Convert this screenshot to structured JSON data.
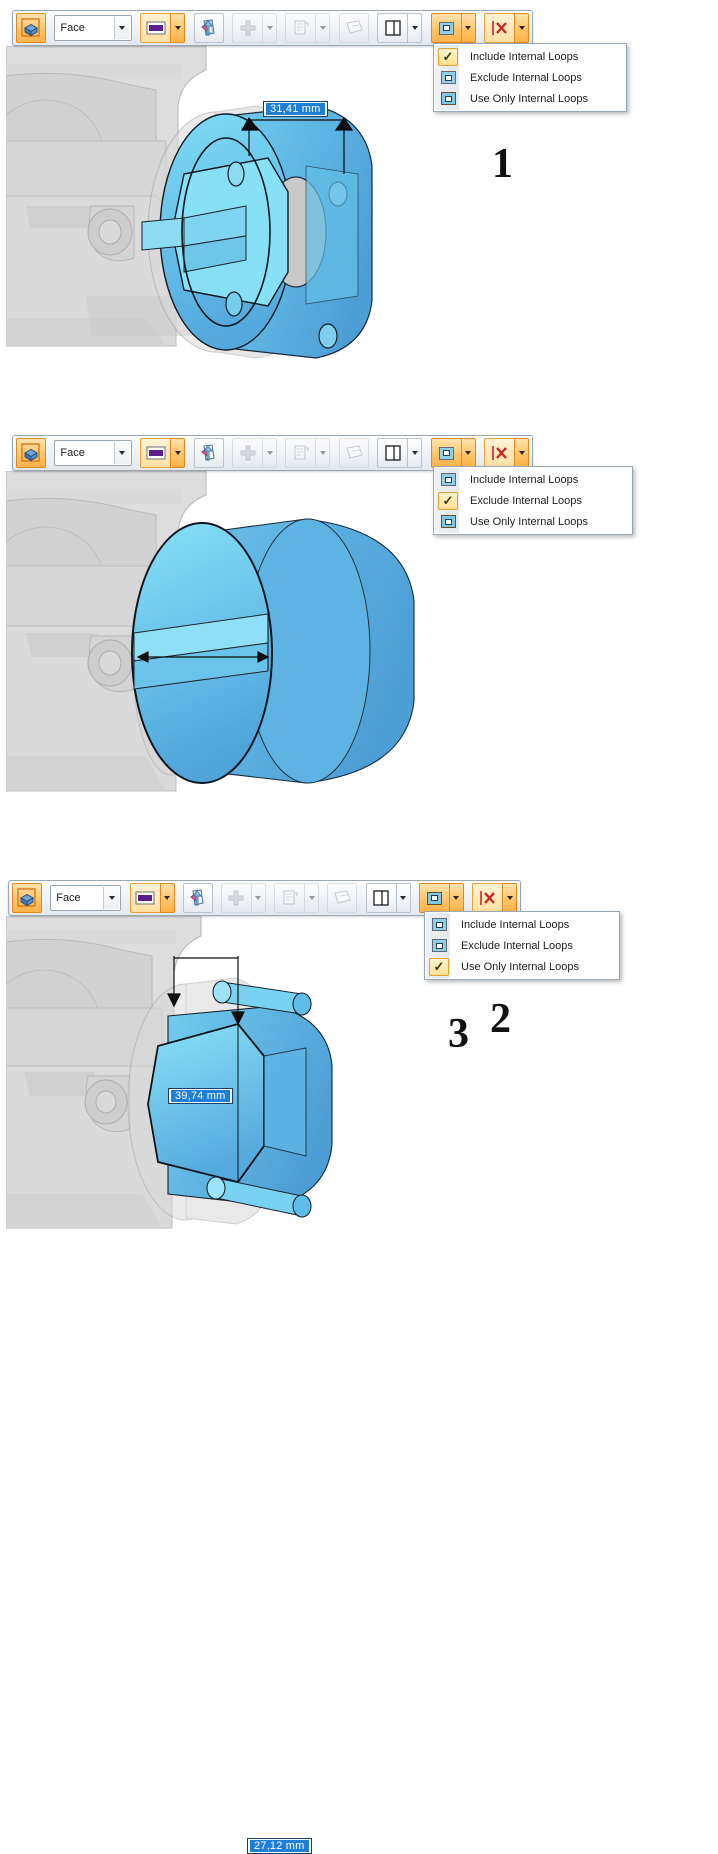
{
  "app": {
    "dimension_unit": "mm",
    "accent_orange": "#ffb347",
    "accent_blue": "#1f7fd4",
    "face_color": "#5fc8e8",
    "body_gray": "#d6d6d6"
  },
  "toolbar": {
    "select_mode_button": "select-solid",
    "selection_filter_value": "Face",
    "selection_filter_placeholder": "Face",
    "color_swatch_label": "",
    "direction_button": "flip-direction",
    "add_button": "add",
    "copy_button": "copy",
    "taper_button": "taper",
    "extents_button": "extents",
    "loops_button": "internal-loops",
    "cancel_button": "cancel"
  },
  "menu": {
    "items": [
      {
        "label": "Include Internal Loops",
        "icon": "loop-include-icon"
      },
      {
        "label": "Exclude Internal Loops",
        "icon": "loop-exclude-icon"
      },
      {
        "label": "Use Only Internal Loops",
        "icon": "loop-only-icon"
      }
    ]
  },
  "panels": [
    {
      "step": "1",
      "checked_index": 0,
      "dimension": "31,41 mm",
      "mode": "Include Internal Loops"
    },
    {
      "step": "2",
      "checked_index": 1,
      "dimension": "39,74 mm",
      "mode": "Exclude Internal Loops"
    },
    {
      "step": "3",
      "checked_index": 2,
      "dimension": "27,12 mm",
      "mode": "Use Only Internal Loops"
    }
  ]
}
